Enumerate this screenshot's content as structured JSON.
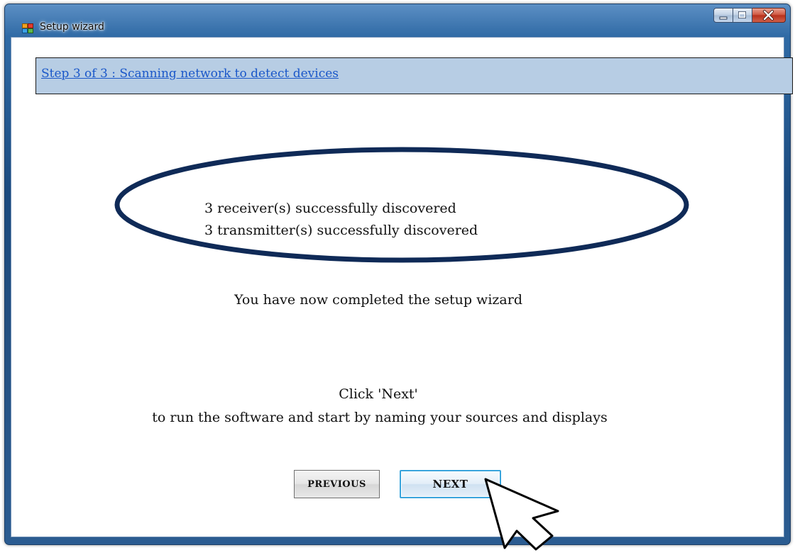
{
  "window": {
    "title": "Setup wizard",
    "controls": {
      "minimize": "minimize",
      "maximize": "maximize",
      "close": "close"
    }
  },
  "step_header": {
    "text": "Step 3 of 3 : Scanning network to detect devices"
  },
  "discovery": {
    "receivers": "3 receiver(s) successfully discovered",
    "transmitters": "3 transmitter(s) successfully discovered"
  },
  "completion_message": "You have now completed the setup wizard",
  "instruction": {
    "line1": "Click 'Next'",
    "line2": "to run the software and start by naming your sources and displays"
  },
  "buttons": {
    "previous": "PREVIOUS",
    "next": "NEXT"
  },
  "icons": {
    "app": "application-window-icon",
    "cursor": "arrow-pointer-icon"
  },
  "colors": {
    "header_band": "#b7cde4",
    "link": "#1a57c9",
    "highlight_ellipse": "#0f2a57",
    "next_focus_border": "#39a4dc",
    "close_button": "#c8422c"
  }
}
